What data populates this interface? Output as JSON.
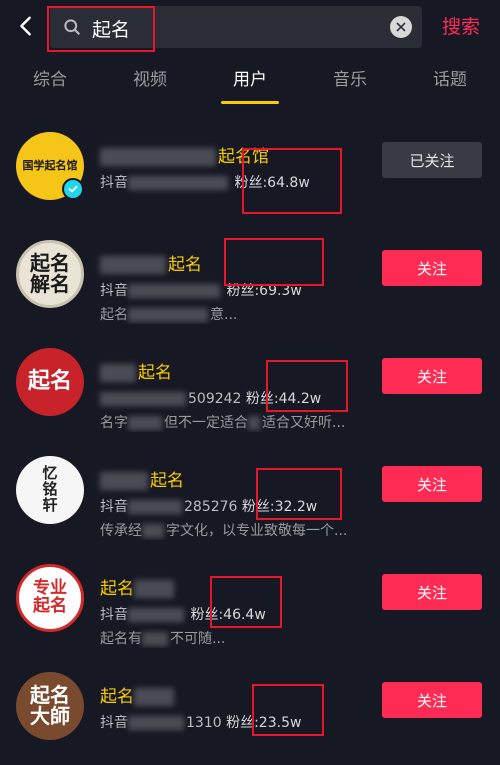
{
  "search": {
    "query": "起名",
    "button_label": "搜索"
  },
  "tabs": [
    {
      "label": "综合"
    },
    {
      "label": "视频"
    },
    {
      "label": "用户"
    },
    {
      "label": "音乐"
    },
    {
      "label": "话题"
    }
  ],
  "active_tab": "用户",
  "users": [
    {
      "avatar_text": "国学起名馆",
      "name": "起名馆",
      "meta_prefix": "抖音",
      "fans": "粉丝:64.8w",
      "desc": "",
      "follow_label": "已关注",
      "verified": true
    },
    {
      "avatar_text": "起名解名",
      "name": "起名",
      "meta_prefix": "抖音",
      "fans": "粉丝:69.3w",
      "desc": "起名",
      "desc_tail": "意...",
      "follow_label": "关注"
    },
    {
      "avatar_text": "起名",
      "name": "起名",
      "meta_prefix": "",
      "meta_id": "509242",
      "fans": "粉丝:44.2w",
      "desc": "名字",
      "desc_mid": "但不一定适合",
      "desc_tail": "适合又好听...",
      "follow_label": "关注"
    },
    {
      "avatar_text": "忆铭轩",
      "name": "起名",
      "meta_prefix": "抖音",
      "meta_id": "285276",
      "fans": "粉丝:32.2w",
      "desc": "传承经",
      "desc_tail": "字文化，以专业致敬每一个...",
      "follow_label": "关注"
    },
    {
      "avatar_text": "专业起名",
      "name": "起名",
      "meta_prefix": "抖音",
      "fans": "粉丝:46.4w",
      "desc": "起名有",
      "desc_tail": "不可随...",
      "follow_label": "关注"
    },
    {
      "avatar_text": "起名大師",
      "name": "起名",
      "meta_prefix": "抖音",
      "meta_id": "1310",
      "fans": "粉丝:23.5w",
      "desc": "",
      "follow_label": "关注"
    }
  ]
}
